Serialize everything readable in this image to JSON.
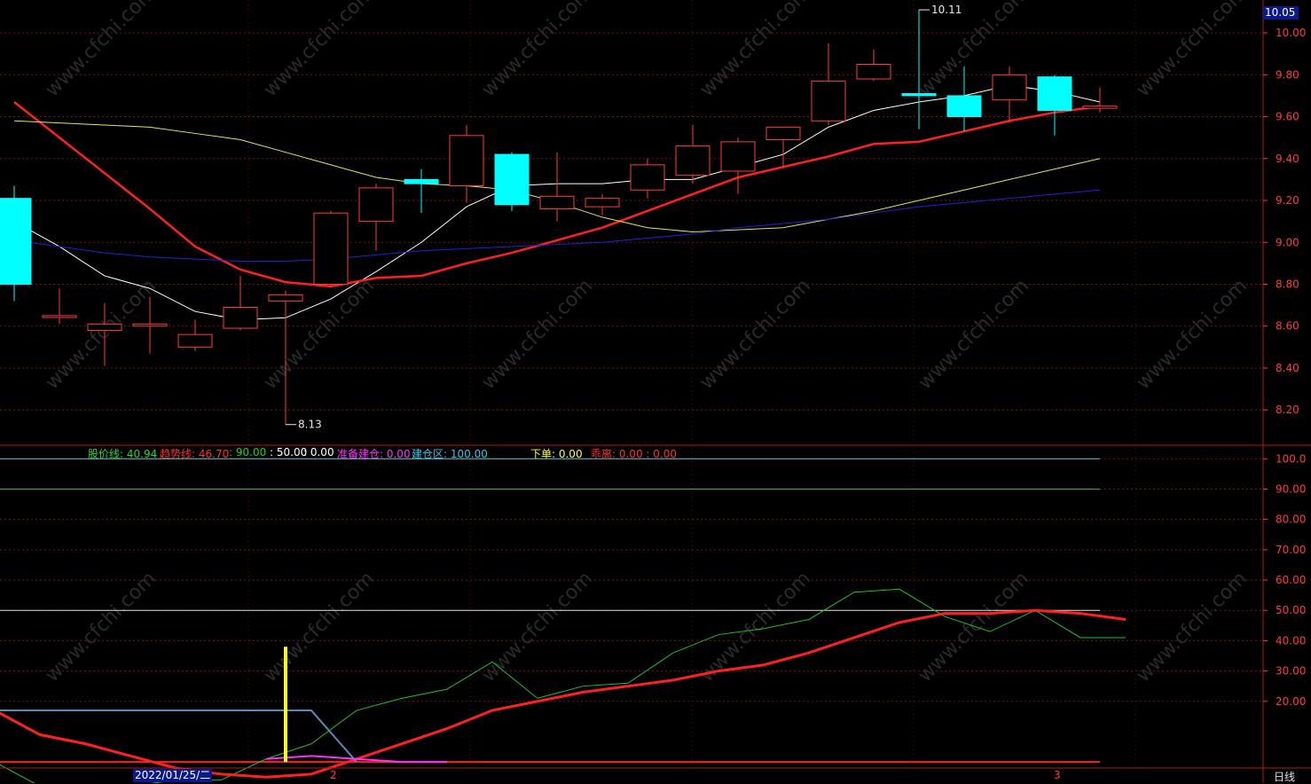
{
  "chart_data": [
    {
      "type": "candlestick",
      "yaxis_ticks": [
        "10.00",
        "9.80",
        "9.60",
        "9.40",
        "9.20",
        "9.00",
        "8.80",
        "8.60",
        "8.40",
        "8.20"
      ],
      "ylim": [
        8.04,
        10.14
      ],
      "current_price": "10.05",
      "high_label": "10.11",
      "low_label": "8.13",
      "high_value": 10.11,
      "low_value": 8.13,
      "candles": [
        {
          "o": 9.21,
          "c": 8.8,
          "h": 9.27,
          "l": 8.72
        },
        {
          "o": 8.65,
          "c": 8.65,
          "h": 8.78,
          "l": 8.61
        },
        {
          "o": 8.58,
          "c": 8.61,
          "h": 8.71,
          "l": 8.41
        },
        {
          "o": 8.6,
          "c": 8.61,
          "h": 8.74,
          "l": 8.47
        },
        {
          "o": 8.5,
          "c": 8.56,
          "h": 8.63,
          "l": 8.48
        },
        {
          "o": 8.59,
          "c": 8.69,
          "h": 8.84,
          "l": 8.58
        },
        {
          "o": 8.72,
          "c": 8.75,
          "h": 8.77,
          "l": 8.13
        },
        {
          "o": 8.8,
          "c": 9.14,
          "h": 9.15,
          "l": 8.79
        },
        {
          "o": 9.1,
          "c": 9.26,
          "h": 9.28,
          "l": 8.96
        },
        {
          "o": 9.3,
          "c": 9.28,
          "h": 9.35,
          "l": 9.14
        },
        {
          "o": 9.27,
          "c": 9.51,
          "h": 9.56,
          "l": 9.19
        },
        {
          "o": 9.42,
          "c": 9.18,
          "h": 9.43,
          "l": 9.15
        },
        {
          "o": 9.16,
          "c": 9.22,
          "h": 9.43,
          "l": 9.1
        },
        {
          "o": 9.17,
          "c": 9.21,
          "h": 9.23,
          "l": 9.13
        },
        {
          "o": 9.25,
          "c": 9.37,
          "h": 9.4,
          "l": 9.21
        },
        {
          "o": 9.32,
          "c": 9.46,
          "h": 9.56,
          "l": 9.28
        },
        {
          "o": 9.34,
          "c": 9.48,
          "h": 9.5,
          "l": 9.23
        },
        {
          "o": 9.49,
          "c": 9.55,
          "h": 9.55,
          "l": 9.36
        },
        {
          "o": 9.58,
          "c": 9.77,
          "h": 9.95,
          "l": 9.56
        },
        {
          "o": 9.78,
          "c": 9.85,
          "h": 9.92,
          "l": 9.77
        },
        {
          "o": 9.71,
          "c": 9.7,
          "h": 10.11,
          "l": 9.54
        },
        {
          "o": 9.7,
          "c": 9.6,
          "h": 9.84,
          "l": 9.53
        },
        {
          "o": 9.68,
          "c": 9.8,
          "h": 9.84,
          "l": 9.57
        },
        {
          "o": 9.79,
          "c": 9.63,
          "h": 9.8,
          "l": 9.51
        },
        {
          "o": 9.64,
          "c": 9.65,
          "h": 9.74,
          "l": 9.62
        }
      ],
      "moving_averages": [
        {
          "color": "#ffffff",
          "values": [
            9.1,
            8.98,
            8.84,
            8.78,
            8.67,
            8.63,
            8.64,
            8.73,
            8.86,
            9.0,
            9.17,
            9.27,
            9.28,
            9.28,
            9.3,
            9.3,
            9.36,
            9.42,
            9.55,
            9.63,
            9.67,
            9.7,
            9.75,
            9.72,
            9.67
          ]
        },
        {
          "color": "#ff2020",
          "values": [
            9.67,
            9.5,
            9.33,
            9.16,
            8.98,
            8.87,
            8.81,
            8.79,
            8.83,
            8.84,
            8.9,
            8.95,
            9.01,
            9.07,
            9.15,
            9.23,
            9.31,
            9.36,
            9.41,
            9.47,
            9.48,
            9.53,
            9.58,
            9.62,
            9.65
          ]
        },
        {
          "color": "#e6e64c",
          "values": [
            9.58,
            9.57,
            9.56,
            9.55,
            9.52,
            9.49,
            9.43,
            9.37,
            9.31,
            9.28,
            9.27,
            9.25,
            9.19,
            9.12,
            9.07,
            9.05,
            9.06,
            9.07,
            9.11,
            9.15,
            9.2,
            9.25,
            9.3,
            9.35,
            9.4
          ]
        },
        {
          "color": "#2020dd",
          "values": [
            9.01,
            8.98,
            8.95,
            8.93,
            8.92,
            8.91,
            8.91,
            8.92,
            8.94,
            8.96,
            8.97,
            8.98,
            8.99,
            9.0,
            9.02,
            9.04,
            9.07,
            9.09,
            9.11,
            9.14,
            9.17,
            9.19,
            9.21,
            9.23,
            9.25
          ]
        }
      ]
    },
    {
      "type": "line",
      "yaxis_ticks": [
        "100.0",
        "90.00",
        "80.00",
        "70.00",
        "60.00",
        "50.00",
        "40.00",
        "30.00",
        "20.00"
      ],
      "ylim": [
        -2,
        103
      ],
      "legend": [
        {
          "label": "股价线:",
          "value": "40.94",
          "color": "#26d926"
        },
        {
          "label": "趋势线:",
          "value": "46.70",
          "color": "#ff3030"
        },
        {
          "label": "",
          "value": ": 90.00",
          "color": "#20d020"
        },
        {
          "label": "",
          "value": ": 50.00",
          "color": "#ffffff"
        },
        {
          "label": "",
          "value": ": 0.00",
          "color": "#ffffff"
        },
        {
          "label": "准备建仓:",
          "value": "0.00",
          "color": "#ff30ff"
        },
        {
          "label": "建仓区:",
          "value": "100.00",
          "color": "#30c8e8"
        },
        {
          "label": "下单:",
          "value": "0.00",
          "color": "#ffff30"
        },
        {
          "label": "乖离:",
          "value": "0.00 : 0.00",
          "color": "#ff3030"
        }
      ],
      "hlines": [
        {
          "value": 100,
          "color": "#6fc4d6"
        },
        {
          "value": 90,
          "color": "#20c020"
        },
        {
          "value": 50,
          "color": "#e0e0e0"
        },
        {
          "value": 0,
          "color": "#ff2020"
        }
      ],
      "series": [
        {
          "color": "#20c020",
          "width": 1,
          "values": [
            0,
            -8,
            -9,
            -8,
            -6,
            -6,
            1,
            6,
            17,
            21,
            24,
            33,
            21,
            25,
            26,
            36,
            42,
            44,
            47,
            56,
            57,
            48,
            43,
            50,
            41,
            41
          ]
        },
        {
          "color": "#ff2020",
          "width": 3,
          "values": [
            17,
            9,
            6,
            2,
            -2,
            -4,
            -5,
            -4,
            1,
            6,
            11,
            17,
            20,
            23,
            25,
            27,
            30,
            32,
            36,
            41,
            46,
            49,
            49,
            50,
            49,
            47
          ]
        },
        {
          "color": "#5a8ab8",
          "width": 2,
          "values": [
            17,
            17,
            17,
            17,
            17,
            17,
            17,
            17,
            0
          ]
        },
        {
          "color": "#ff30ff",
          "width": 2,
          "values": [
            null,
            null,
            null,
            null,
            null,
            null,
            1,
            2,
            1,
            0,
            0
          ]
        }
      ],
      "signal_bar": {
        "index": 6,
        "value": 38,
        "color": "#ffff20"
      }
    }
  ],
  "xaxis": {
    "date_label": "2022/01/25/二",
    "ticks": [
      {
        "label": "2",
        "index": 7
      },
      {
        "label": "3",
        "index": 23
      }
    ],
    "period": "日线"
  }
}
